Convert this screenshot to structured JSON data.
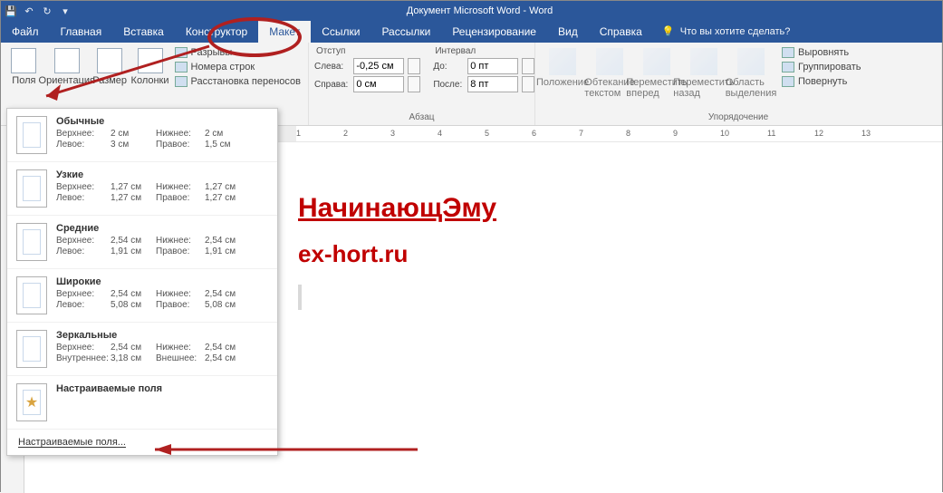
{
  "titlebar": {
    "title": "Документ Microsoft Word  -  Word"
  },
  "tabs": {
    "file": "Файл",
    "items": [
      "Главная",
      "Вставка",
      "Конструктор",
      "Макет",
      "Ссылки",
      "Рассылки",
      "Рецензирование",
      "Вид",
      "Справка"
    ],
    "active_index": 3,
    "tell_me": "Что вы хотите сделать?"
  },
  "ribbon": {
    "page_setup": {
      "margins": "Поля",
      "orientation": "Ориентация",
      "size": "Размер",
      "columns": "Колонки",
      "breaks": "Разрывы",
      "line_numbers": "Номера строк",
      "hyphenation": "Расстановка переносов"
    },
    "paragraph": {
      "indent_hdr": "Отступ",
      "spacing_hdr": "Интервал",
      "left_lbl": "Слева:",
      "right_lbl": "Справа:",
      "before_lbl": "До:",
      "after_lbl": "После:",
      "left_val": "-0,25 см",
      "right_val": "0 см",
      "before_val": "0 пт",
      "after_val": "8 пт",
      "group_label": "Абзац"
    },
    "arrange": {
      "position": "Положение",
      "wrap": "Обтекание текстом",
      "forward": "Переместить вперед",
      "backward": "Переместить назад",
      "selection_pane": "Область выделения",
      "align": "Выровнять",
      "group": "Группировать",
      "rotate": "Повернуть",
      "group_label": "Упорядочение"
    }
  },
  "margins_menu": {
    "presets": [
      {
        "name": "Обычные",
        "t_lbl": "Верхнее:",
        "t": "2 см",
        "b_lbl": "Нижнее:",
        "b": "2 см",
        "l_lbl": "Левое:",
        "l": "3 см",
        "r_lbl": "Правое:",
        "r": "1,5 см"
      },
      {
        "name": "Узкие",
        "t_lbl": "Верхнее:",
        "t": "1,27 см",
        "b_lbl": "Нижнее:",
        "b": "1,27 см",
        "l_lbl": "Левое:",
        "l": "1,27 см",
        "r_lbl": "Правое:",
        "r": "1,27 см"
      },
      {
        "name": "Средние",
        "t_lbl": "Верхнее:",
        "t": "2,54 см",
        "b_lbl": "Нижнее:",
        "b": "2,54 см",
        "l_lbl": "Левое:",
        "l": "1,91 см",
        "r_lbl": "Правое:",
        "r": "1,91 см"
      },
      {
        "name": "Широкие",
        "t_lbl": "Верхнее:",
        "t": "2,54 см",
        "b_lbl": "Нижнее:",
        "b": "2,54 см",
        "l_lbl": "Левое:",
        "l": "5,08 см",
        "r_lbl": "Правое:",
        "r": "5,08 см"
      },
      {
        "name": "Зеркальные",
        "t_lbl": "Верхнее:",
        "t": "2,54 см",
        "b_lbl": "Нижнее:",
        "b": "2,54 см",
        "l_lbl": "Внутреннее:",
        "l": "3,18 см",
        "r_lbl": "Внешнее:",
        "r": "2,54 см"
      }
    ],
    "custom_recent": "Настраиваемые поля",
    "custom_cmd": "Настраиваемые поля..."
  },
  "document": {
    "heading": "НачинающЭму",
    "subtext": "ex-hort.ru"
  },
  "ruler": {
    "marks": [
      1,
      2,
      3,
      4,
      5,
      6,
      7,
      8,
      9,
      10,
      11,
      12,
      13
    ]
  }
}
